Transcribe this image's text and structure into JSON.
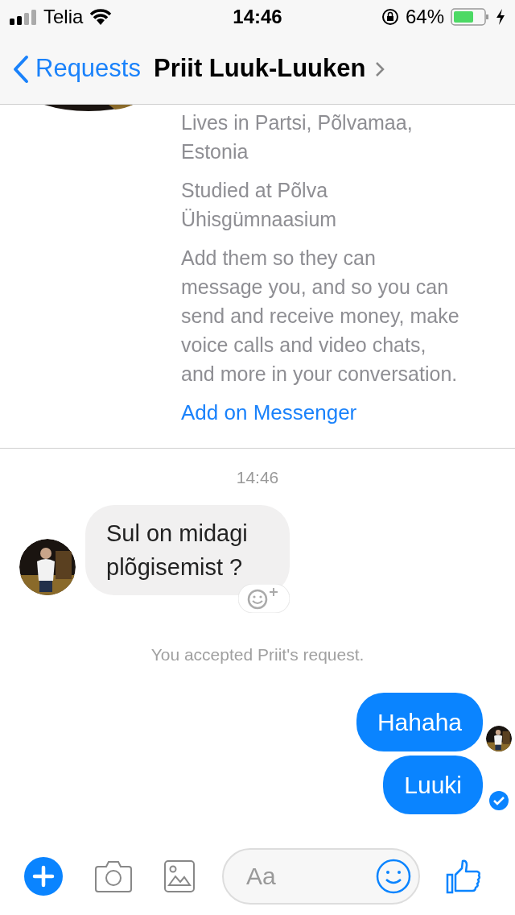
{
  "status_bar": {
    "carrier": "Telia",
    "time": "14:46",
    "battery": "64%"
  },
  "nav": {
    "back": "Requests",
    "title": "Priit Luuk-Luuken"
  },
  "profile": {
    "details": [
      {
        "lines": [
          "Lives in Partsi, Põlvamaa,",
          "Estonia"
        ]
      },
      {
        "lines": [
          "Studied at Põlva",
          "Ühisgümnaasium"
        ]
      },
      {
        "lines": [
          "Add them so they can",
          "message you, and so you can",
          "send and receive money, make",
          "voice calls and video chats,",
          "and more in your conversation."
        ]
      }
    ],
    "action": "Add on Messenger"
  },
  "messages": [
    {
      "kind": "time",
      "text": "14:46"
    },
    {
      "kind": "incoming",
      "text": "Sul on midagi plõgisemist ?"
    },
    {
      "kind": "system",
      "text": "You accepted Priit's request."
    },
    {
      "kind": "outgoing",
      "text": "Hahaha",
      "seen": true,
      "delivered": false
    },
    {
      "kind": "outgoing",
      "text": "Luuki",
      "seen": false,
      "delivered": true
    }
  ],
  "composer": {
    "placeholder": "Aa"
  }
}
